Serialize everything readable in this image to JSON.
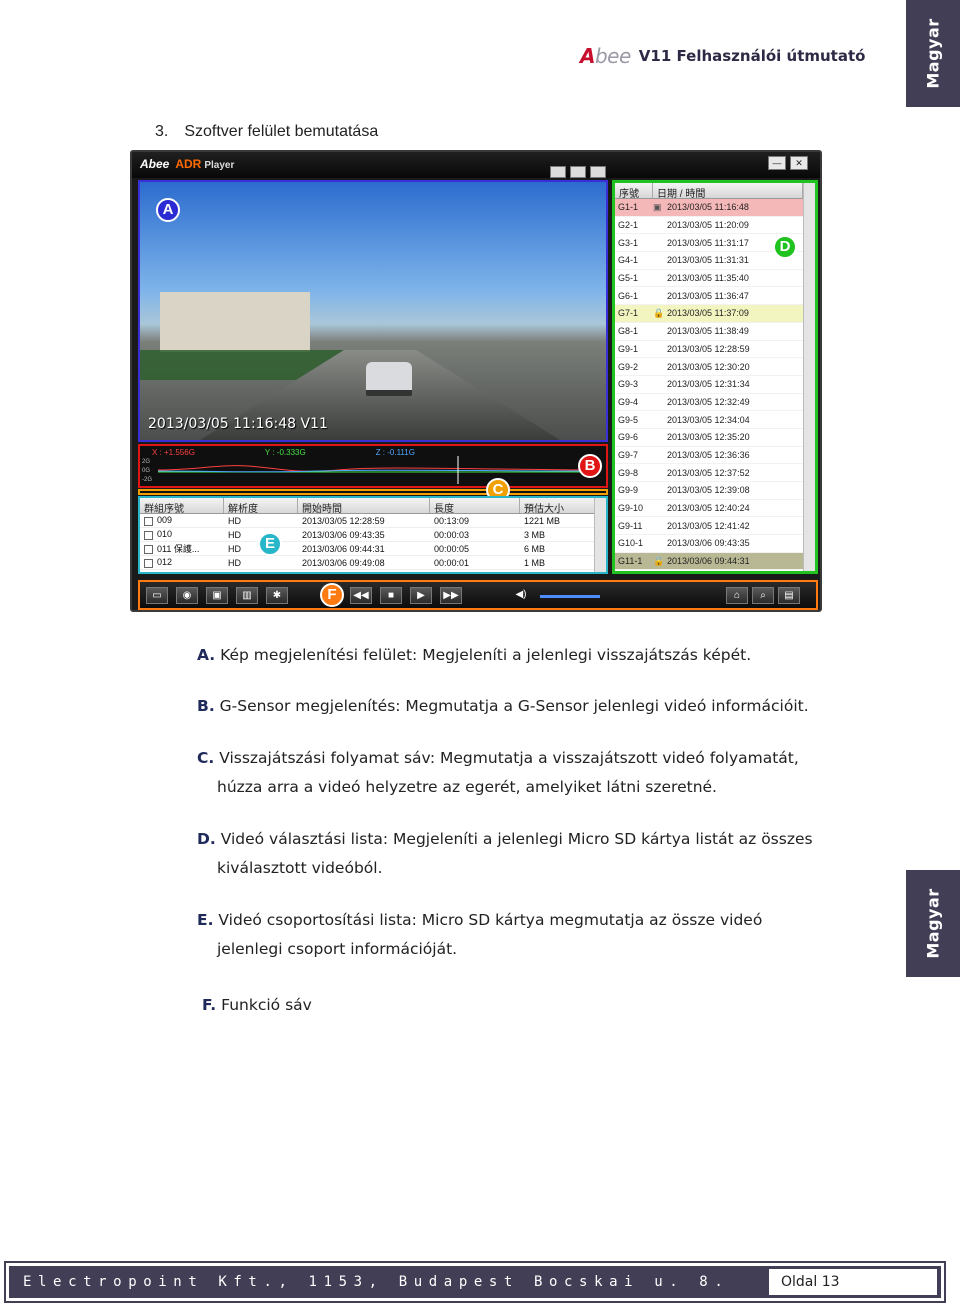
{
  "side_tab_label": "Magyar",
  "header": {
    "logo_a": "A",
    "logo_rest": "bee",
    "doc_title": "V11 Felhasználói útmutató"
  },
  "section": {
    "number": "3.",
    "title": "Szoftver felület bemutatása"
  },
  "app": {
    "logo": "Abee",
    "adr": "ADR",
    "player": "Player",
    "overlay_timestamp": "2013/03/05  11:16:48  V11",
    "markers": {
      "a": "A",
      "b": "B",
      "c": "C",
      "d": "D",
      "e": "E",
      "f": "F"
    },
    "gsensor": {
      "x": "X : +1.556G",
      "y": "Y : -0.333G",
      "z": "Z : -0.111G",
      "axis": [
        "2G",
        "0G",
        "-2G"
      ]
    },
    "group_list": {
      "headers": [
        "群組序號",
        "解析度",
        "開始時間",
        "長度",
        "預估大小"
      ],
      "rows": [
        {
          "id": "009",
          "res": "HD",
          "start": "2013/03/05 12:28:59",
          "len": "00:13:09",
          "size": "1221 MB"
        },
        {
          "id": "010",
          "res": "HD",
          "start": "2013/03/06 09:43:35",
          "len": "00:00:03",
          "size": "3 MB"
        },
        {
          "id": "011 保護...",
          "res": "HD",
          "start": "2013/03/06 09:44:31",
          "len": "00:00:05",
          "size": "6 MB"
        },
        {
          "id": "012",
          "res": "HD",
          "start": "2013/03/06 09:49:08",
          "len": "00:00:01",
          "size": "1 MB"
        }
      ]
    },
    "video_list": {
      "headers": [
        "序號",
        "日期 / 時間"
      ],
      "rows": [
        {
          "id": "G1-1",
          "dt": "2013/03/05 11:16:48",
          "state": "sel",
          "icon": "▣"
        },
        {
          "id": "G2-1",
          "dt": "2013/03/05 11:20:09",
          "state": "",
          "icon": ""
        },
        {
          "id": "G3-1",
          "dt": "2013/03/05 11:31:17",
          "state": "",
          "icon": ""
        },
        {
          "id": "G4-1",
          "dt": "2013/03/05 11:31:31",
          "state": "",
          "icon": ""
        },
        {
          "id": "G5-1",
          "dt": "2013/03/05 11:35:40",
          "state": "",
          "icon": ""
        },
        {
          "id": "G6-1",
          "dt": "2013/03/05 11:36:47",
          "state": "",
          "icon": ""
        },
        {
          "id": "G7-1",
          "dt": "2013/03/05 11:37:09",
          "state": "alt",
          "icon": "🔒"
        },
        {
          "id": "G8-1",
          "dt": "2013/03/05 11:38:49",
          "state": "",
          "icon": ""
        },
        {
          "id": "G9-1",
          "dt": "2013/03/05 12:28:59",
          "state": "",
          "icon": ""
        },
        {
          "id": "G9-2",
          "dt": "2013/03/05 12:30:20",
          "state": "",
          "icon": ""
        },
        {
          "id": "G9-3",
          "dt": "2013/03/05 12:31:34",
          "state": "",
          "icon": ""
        },
        {
          "id": "G9-4",
          "dt": "2013/03/05 12:32:49",
          "state": "",
          "icon": ""
        },
        {
          "id": "G9-5",
          "dt": "2013/03/05 12:34:04",
          "state": "",
          "icon": ""
        },
        {
          "id": "G9-6",
          "dt": "2013/03/05 12:35:20",
          "state": "",
          "icon": ""
        },
        {
          "id": "G9-7",
          "dt": "2013/03/05 12:36:36",
          "state": "",
          "icon": ""
        },
        {
          "id": "G9-8",
          "dt": "2013/03/05 12:37:52",
          "state": "",
          "icon": ""
        },
        {
          "id": "G9-9",
          "dt": "2013/03/05 12:39:08",
          "state": "",
          "icon": ""
        },
        {
          "id": "G9-10",
          "dt": "2013/03/05 12:40:24",
          "state": "",
          "icon": ""
        },
        {
          "id": "G9-11",
          "dt": "2013/03/05 12:41:42",
          "state": "",
          "icon": ""
        },
        {
          "id": "G10-1",
          "dt": "2013/03/06 09:43:35",
          "state": "",
          "icon": ""
        },
        {
          "id": "G11-1",
          "dt": "2013/03/06 09:44:31",
          "state": "last",
          "icon": "🔒"
        }
      ]
    },
    "toolbar": {
      "open_icon": "open-folder-icon",
      "snapshot_icon": "camera-icon",
      "save_icon": "save-icon",
      "delete_icon": "trash-icon",
      "settings_icon": "gear-icon",
      "rewind_icon": "rewind-icon",
      "stop_icon": "stop-icon",
      "play_icon": "play-icon",
      "forward_icon": "fast-forward-icon",
      "volume_icon": "speaker-icon"
    }
  },
  "descriptions": [
    {
      "key": "A.",
      "text": "Kép megjelenítési felület: Megjeleníti a jelenlegi visszajátszás képét.",
      "cont": ""
    },
    {
      "key": "B.",
      "text": "G-Sensor megjelenítés: Megmutatja a G-Sensor jelenlegi videó információit.",
      "cont": ""
    },
    {
      "key": "C.",
      "text": "Visszajátszási folyamat sáv: Megmutatja a visszajátszott videó folyamatát,",
      "cont": "húzza arra a videó helyzetre az egerét, amelyiket látni szeretné."
    },
    {
      "key": "D.",
      "text": "Videó választási lista: Megjeleníti a jelenlegi Micro SD kártya listát az összes",
      "cont": "kiválasztott videóból."
    },
    {
      "key": "E.",
      "text": "Videó csoportosítási lista: Micro SD kártya megmutatja az össze videó",
      "cont": "jelenlegi csoport információját."
    },
    {
      "key": "F.",
      "text": "Funkció sáv",
      "cont": ""
    }
  ],
  "footer": {
    "company": "Electropoint Kft., 1153, Budapest Bocskai u. 8.",
    "page": "Oldal 13"
  },
  "colors": {
    "accent": "#413e55",
    "logo_red": "#c8102e",
    "zone_a": "#3a2fd6",
    "zone_b": "#e01616",
    "zone_c": "#f0a000",
    "zone_d": "#1fc21f",
    "zone_e": "#28b6c9",
    "zone_f": "#ff7a10"
  }
}
